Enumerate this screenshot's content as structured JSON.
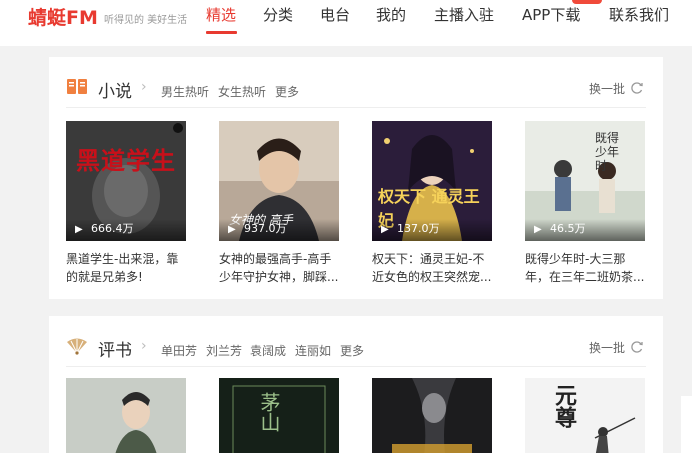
{
  "header": {
    "logo": "蜻蜓FM",
    "slogan": "听得见的 美好生活",
    "nav": [
      "精选",
      "分类",
      "电台",
      "我的",
      "主播入驻",
      "APP下载",
      "联系我们"
    ],
    "active_index": 0
  },
  "sections": [
    {
      "title": "小说",
      "links": [
        "男生热听",
        "女生热听",
        "更多"
      ],
      "refresh": "换一批",
      "items": [
        {
          "plays": "666.4万",
          "title_line1": "黑道学生-出来混，靠",
          "title_line2": "的就是兄弟多!",
          "cover_text": "黑道学生"
        },
        {
          "plays": "937.0万",
          "title_line1": "女神的最强高手-高手",
          "title_line2": "少年守护女神，脚踩...",
          "cover_text": "女神的 高手"
        },
        {
          "plays": "137.0万",
          "title_line1": "权天下：通灵王妃-不",
          "title_line2": "近女色的权王突然宠...",
          "cover_text": "权天下 通灵王妃"
        },
        {
          "plays": "46.5万",
          "title_line1": "既得少年时-大三那",
          "title_line2": "年，在三年二班奶茶...",
          "cover_text": "既得 少年时"
        }
      ]
    },
    {
      "title": "评书",
      "links": [
        "单田芳",
        "刘兰芳",
        "袁阔成",
        "连丽如",
        "更多"
      ],
      "refresh": "换一批",
      "items": [
        {
          "cover_text": ""
        },
        {
          "cover_text": "茅山"
        },
        {
          "cover_text": ""
        },
        {
          "cover_text": "元尊"
        }
      ]
    }
  ],
  "colors": {
    "brand": "#e83a30",
    "background": "#f2f2f2"
  }
}
